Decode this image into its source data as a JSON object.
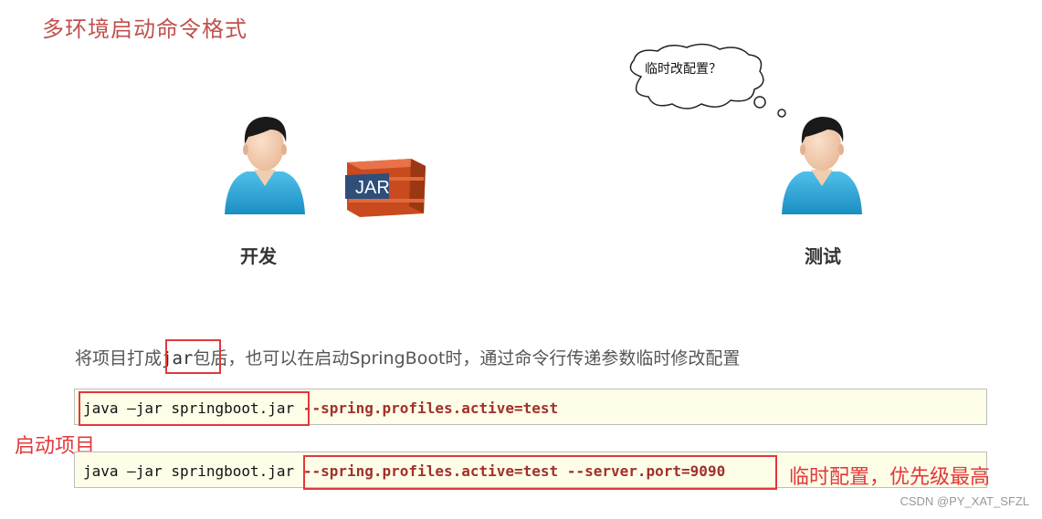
{
  "title": "多环境启动命令格式",
  "developer": {
    "label": "开发",
    "icon": "person-icon"
  },
  "jar_icon": {
    "text": "JAR",
    "icon": "jar-archive-icon"
  },
  "tester": {
    "label": "测试",
    "icon": "person-icon"
  },
  "thought_bubble": "临时改配置？",
  "description": {
    "before": "将项目打成",
    "jar": "jar",
    "after": "包后，也可以在启动SpringBoot时，通过命令行传递参数临时修改配置"
  },
  "command1": {
    "base": "java –jar springboot.jar",
    "args": "--spring.profiles.active=test"
  },
  "command2": {
    "base": "java –jar springboot.jar",
    "args": "--spring.profiles.active=test --server.port=9090"
  },
  "annotations": {
    "start_project": "启动项目",
    "temp_config": "临时配置，优先级最高"
  },
  "watermark": "CSDN @PY_XAT_SFZL",
  "colors": {
    "title": "#c0504d",
    "highlight_box": "#e0393a",
    "code_bg": "#fdfde8",
    "code_arg": "#a0312b",
    "person_shirt": "#29a3d6"
  }
}
